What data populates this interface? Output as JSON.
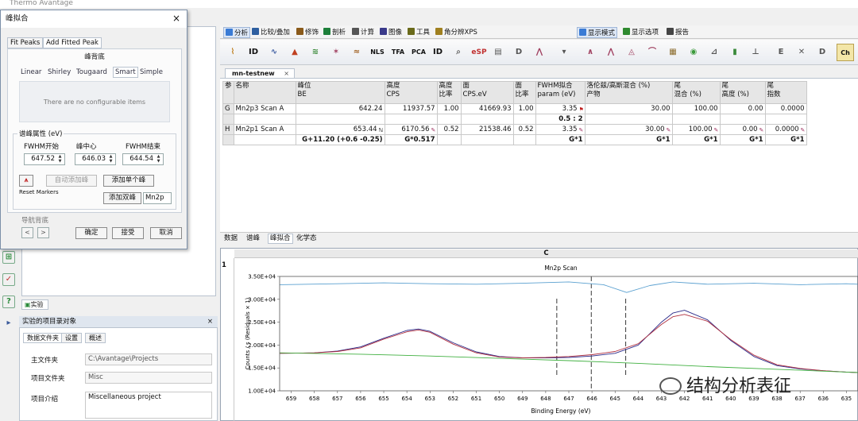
{
  "app": {
    "title": "Thermo Avantage"
  },
  "ribbon": {
    "tabs": [
      {
        "label": "分析",
        "active": true,
        "color": "#3a7bd5"
      },
      {
        "label": "比较/叠加",
        "active": false,
        "color": "#2f5fa0"
      },
      {
        "label": "修饰",
        "active": false,
        "color": "#8a5a1a"
      },
      {
        "label": "剖析",
        "active": false,
        "color": "#1d7f3a"
      },
      {
        "label": "计算",
        "active": false,
        "color": "#555555"
      },
      {
        "label": "图像",
        "active": false,
        "color": "#3a3a8a"
      },
      {
        "label": "工具",
        "active": false,
        "color": "#6a6a1a"
      },
      {
        "label": "角分辨XPS",
        "active": false,
        "color": "#a08020"
      },
      {
        "label": "显示模式",
        "active": true,
        "color": "#3a7bd5"
      },
      {
        "label": "显示选项",
        "active": false,
        "color": "#2f8a2f"
      },
      {
        "label": "报告",
        "active": false,
        "color": "#444444"
      }
    ],
    "toolbar_labels": [
      "ID",
      "NLS",
      "TFA",
      "PCA",
      "ID",
      "eSP",
      "Ch"
    ]
  },
  "document": {
    "tab_label": "mn-testnew",
    "close": "×"
  },
  "peak_table": {
    "headers": [
      {
        "l1": "参",
        "l2": ""
      },
      {
        "l1": "名称",
        "l2": ""
      },
      {
        "l1": "峰位",
        "l2": "BE"
      },
      {
        "l1": "高度",
        "l2": "CPS"
      },
      {
        "l1": "高度",
        "l2": "比率"
      },
      {
        "l1": "面",
        "l2": "CPS.eV"
      },
      {
        "l1": "面",
        "l2": "比率"
      },
      {
        "l1": "FWHM拟合",
        "l2": "param (eV)"
      },
      {
        "l1": "洛伦兹/高斯混合 (%)",
        "l2": "产物"
      },
      {
        "l1": "尾",
        "l2": "混合 (%)"
      },
      {
        "l1": "尾",
        "l2": "高度 (%)"
      },
      {
        "l1": "尾",
        "l2": "指数"
      }
    ],
    "rows": [
      [
        "G",
        "Mn2p3 Scan A",
        "642.24",
        "11937.57",
        "1.00",
        "41669.93",
        "1.00",
        "3.35",
        "30.00",
        "100.00",
        "0.00",
        "0.0000"
      ],
      [
        "",
        "",
        "",
        "",
        "",
        "",
        "",
        "0.5 : 2",
        "",
        "",
        "",
        ""
      ],
      [
        "H",
        "Mn2p1 Scan A",
        "653.44",
        "6170.56",
        "0.52",
        "21538.46",
        "0.52",
        "3.35",
        "30.00",
        "100.00",
        "0.00",
        "0.0000"
      ],
      [
        "",
        "",
        "G+11.20 (+0.6 -0.25)",
        "G*0.517",
        "",
        "",
        "",
        "G*1",
        "G*1",
        "G*1",
        "G*1",
        "G*1"
      ]
    ]
  },
  "bottom_tabs": [
    "数据",
    "谱峰",
    "峰拟合",
    "化学态"
  ],
  "plot_window": {
    "header": "C",
    "index": "1"
  },
  "chart_data": {
    "type": "line",
    "title": "Mn2p Scan",
    "xlabel": "Binding Energy (eV)",
    "ylabel": "Counts / s  (Residuals × 1)",
    "x_reversed": true,
    "xlim": [
      659.5,
      634.5
    ],
    "ylim": [
      10000,
      35000
    ],
    "x_ticks": [
      659,
      658,
      657,
      656,
      655,
      654,
      653,
      652,
      651,
      650,
      649,
      648,
      647,
      646,
      645,
      644,
      643,
      642,
      641,
      640,
      639,
      638,
      637,
      636,
      635
    ],
    "y_ticks": [
      "1.00E+04",
      "1.50E+04",
      "2.00E+04",
      "2.50E+04",
      "3.00E+04",
      "3.50E+04"
    ],
    "y_tick_values": [
      10000,
      15000,
      20000,
      25000,
      30000,
      35000
    ],
    "markers": [
      647.52,
      646.03,
      644.54
    ],
    "series": [
      {
        "color": "#2b2b8a",
        "x": [
          659.5,
          658,
          657,
          656,
          655,
          654,
          653.5,
          653,
          652,
          651,
          650,
          649,
          648,
          647,
          646,
          645,
          644,
          643,
          642.5,
          642,
          641,
          640,
          639,
          638,
          637,
          636,
          635,
          634.5
        ],
        "y": [
          18200,
          18300,
          18700,
          19600,
          21500,
          23200,
          23500,
          23000,
          20500,
          18500,
          17500,
          17200,
          17200,
          17300,
          17600,
          18200,
          20000,
          25000,
          27000,
          27600,
          25500,
          21000,
          17500,
          15500,
          14800,
          14400,
          14100,
          14000
        ]
      },
      {
        "color": "#b03040",
        "x": [
          659.5,
          658,
          657,
          656,
          655,
          654,
          653.5,
          653,
          652,
          651,
          650,
          649,
          648,
          647,
          646,
          645,
          644,
          643,
          642.5,
          642,
          641,
          640,
          639,
          638,
          637,
          636,
          635,
          634.5
        ],
        "y": [
          18200,
          18300,
          18600,
          19400,
          21300,
          22900,
          23300,
          22800,
          20200,
          18300,
          17400,
          17200,
          17300,
          17500,
          17900,
          18600,
          20300,
          24500,
          26200,
          26700,
          25200,
          21200,
          17800,
          15700,
          14900,
          14400,
          14100,
          14000
        ]
      },
      {
        "color": "#40b040",
        "x": [
          659.5,
          656,
          653,
          650,
          647,
          644,
          641,
          638,
          635,
          634.5
        ],
        "y": [
          18300,
          18000,
          17600,
          17100,
          16600,
          16000,
          15300,
          14700,
          14100,
          14000
        ]
      },
      {
        "color": "#5aa0d0",
        "x": [
          659.5,
          657,
          655,
          653,
          651,
          649,
          647,
          645.5,
          644.5,
          643.5,
          642.5,
          641,
          639,
          637,
          635,
          634.5
        ],
        "y": [
          33200,
          33400,
          33600,
          33400,
          33300,
          33500,
          33800,
          33200,
          31500,
          33000,
          33800,
          33300,
          33500,
          33200,
          33400,
          33300
        ]
      }
    ]
  },
  "dialog": {
    "title": "峰拟合",
    "close": "×",
    "tabs": [
      "Fit Peaks",
      "Add Fitted Peak"
    ],
    "background_title": "峰背底",
    "bg_tabs": [
      "Linear",
      "Shirley",
      "Tougaard",
      "Smart",
      "Simple"
    ],
    "no_items": "There are no configurable items",
    "group_label": "谱峰属性 (eV)",
    "fwhm_start_label": "FWHM开始",
    "center_label": "峰中心",
    "fwhm_end_label": "FWHM结束",
    "fwhm_start": "647.52",
    "center": "646.03",
    "fwhm_end": "644.54",
    "marker_label": "Reset Markers",
    "auto_add": "自动添加峰",
    "add_single": "添加单个峰",
    "add_doublet": "添加双峰",
    "doublet_name": "Mn2p",
    "nav_label": "导航背底",
    "nav_prev": "<",
    "nav_next": ">",
    "ok": "确定",
    "accept": "接受",
    "cancel": "取消"
  },
  "left": {
    "exp_tab": "实验",
    "panel_title": "实验的项目录对象",
    "panel_close": "×",
    "subtabs": [
      "数据文件夹",
      "设置",
      "概述"
    ],
    "fields": [
      {
        "label": "主文件夹",
        "value": "C:\\Avantage\\Projects"
      },
      {
        "label": "项目文件夹",
        "value": "Misc"
      },
      {
        "label": "项目介绍",
        "value": "Miscellaneous project"
      }
    ]
  },
  "watermark": "结构分析表征"
}
